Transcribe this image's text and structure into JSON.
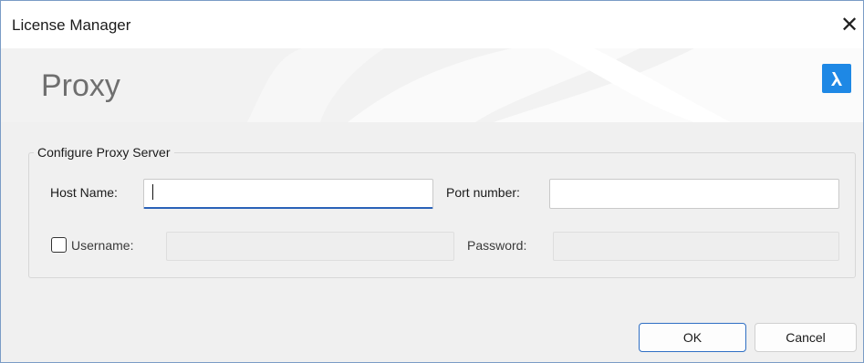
{
  "window": {
    "title": "License Manager",
    "close_glyph": "✕"
  },
  "banner": {
    "title": "Proxy",
    "brand_icon": "bricscad-logo-icon",
    "brand_color": "#1e88e5"
  },
  "group": {
    "legend": "Configure Proxy Server",
    "host_label": "Host Name:",
    "host_value": "",
    "port_label": "Port number:",
    "port_value": "",
    "username_label": "Username:",
    "username_checked": false,
    "username_value": "",
    "password_label": "Password:",
    "password_value": ""
  },
  "buttons": {
    "ok": "OK",
    "cancel": "Cancel"
  },
  "colors": {
    "focus_accent": "#2a62b8",
    "primary_border": "#2f6fc4"
  }
}
